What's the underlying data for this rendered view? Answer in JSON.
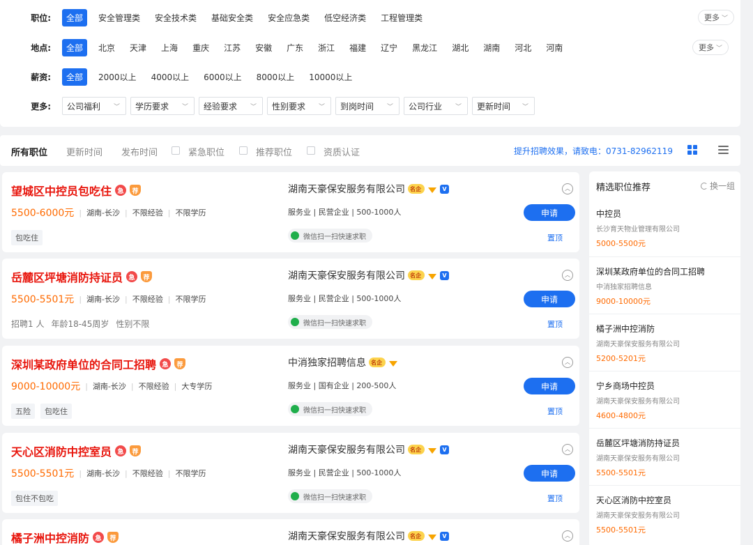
{
  "filters": {
    "position": {
      "label": "职位:",
      "options": [
        "全部",
        "安全管理类",
        "安全技术类",
        "基础安全类",
        "安全应急类",
        "低空经济类",
        "工程管理类"
      ],
      "more": "更多"
    },
    "location": {
      "label": "地点:",
      "options": [
        "全部",
        "北京",
        "天津",
        "上海",
        "重庆",
        "江苏",
        "安徽",
        "广东",
        "浙江",
        "福建",
        "辽宁",
        "黑龙江",
        "湖北",
        "湖南",
        "河北",
        "河南"
      ],
      "more": "更多"
    },
    "salary": {
      "label": "薪资:",
      "options": [
        "全部",
        "2000以上",
        "4000以上",
        "6000以上",
        "8000以上",
        "10000以上"
      ]
    },
    "extra": {
      "label": "更多:",
      "dropdowns": [
        "公司福利",
        "学历要求",
        "经验要求",
        "性别要求",
        "到岗时间",
        "公司行业",
        "更新时间"
      ]
    }
  },
  "toolbar": {
    "all_jobs": "所有职位",
    "update_time": "更新时间",
    "publish_time": "发布时间",
    "urgent": "紧急职位",
    "recommended": "推荐职位",
    "certified": "资质认证",
    "hotline": "提升招聘效果，请致电：0731-82962119"
  },
  "jobs": [
    {
      "title": "望城区中控员包吃住",
      "salary": "5500-6000元",
      "location": "湖南-长沙",
      "experience": "不限经验",
      "education": "不限学历",
      "tags": [
        "包吃住"
      ],
      "company": "湖南天豪保安服务有限公司",
      "company_type": "服务业 | 民营企业 | 500-1000人",
      "verified": true
    },
    {
      "title": "岳麓区坪塘消防持证员",
      "salary": "5500-5501元",
      "location": "湖南-长沙",
      "experience": "不限经验",
      "education": "不限学历",
      "info": [
        "招聘1 人",
        "年龄18-45周岁",
        "性别不限"
      ],
      "company": "湖南天豪保安服务有限公司",
      "company_type": "服务业 | 民营企业 | 500-1000人",
      "verified": true
    },
    {
      "title": "深圳某政府单位的合同工招聘",
      "salary": "9000-10000元",
      "location": "湖南-长沙",
      "experience": "不限经验",
      "education": "大专学历",
      "tags": [
        "五险",
        "包吃住"
      ],
      "company": "中消独家招聘信息",
      "company_type": "服务业 | 国有企业 | 200-500人",
      "verified": false
    },
    {
      "title": "天心区消防中控室员",
      "salary": "5500-5501元",
      "location": "湖南-长沙",
      "experience": "不限经验",
      "education": "不限学历",
      "tags": [
        "包住不包吃"
      ],
      "company": "湖南天豪保安服务有限公司",
      "company_type": "服务业 | 民营企业 | 500-1000人",
      "verified": true
    },
    {
      "title": "橘子洲中控消防",
      "company": "湖南天豪保安服务有限公司",
      "verified": true
    }
  ],
  "card_common": {
    "badge_urgent": "急",
    "badge_recommend": "荐",
    "famous": "名企",
    "verified_mark": "V",
    "wechat": "微信扫一扫快速求职",
    "apply": "申请",
    "pin": "置顶",
    "collapse": "︿"
  },
  "recommend": {
    "title": "精选职位推荐",
    "refresh": "换一组",
    "items": [
      {
        "title": "中控员",
        "company": "长沙育天物业管理有限公司",
        "salary": "5000-5500元"
      },
      {
        "title": "深圳某政府单位的合同工招聘",
        "company": "中消独家招聘信息",
        "salary": "9000-10000元"
      },
      {
        "title": "橘子洲中控消防",
        "company": "湖南天豪保安服务有限公司",
        "salary": "5200-5201元"
      },
      {
        "title": "宁乡商场中控员",
        "company": "湖南天豪保安服务有限公司",
        "salary": "4600-4800元"
      },
      {
        "title": "岳麓区坪塘消防持证员",
        "company": "湖南天豪保安服务有限公司",
        "salary": "5500-5501元"
      },
      {
        "title": "天心区消防中控室员",
        "company": "湖南天豪保安服务有限公司",
        "salary": "5500-5501元"
      }
    ]
  },
  "colors": {
    "accent": "#1d6ff0",
    "title_red": "#e8150c",
    "salary_orange": "#ff6a00"
  }
}
